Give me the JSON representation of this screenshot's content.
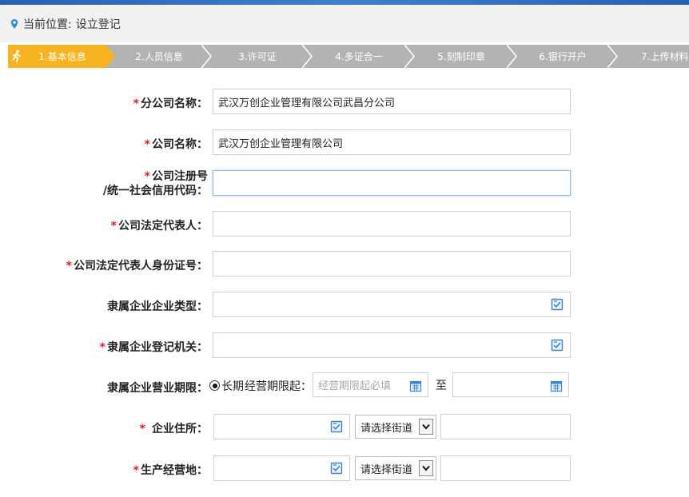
{
  "breadcrumb": {
    "prefix": "当前位置:",
    "current": "设立登记"
  },
  "steps": [
    {
      "label": "1.基本信息",
      "active": true
    },
    {
      "label": "2.人员信息",
      "active": false
    },
    {
      "label": "3.许可证",
      "active": false
    },
    {
      "label": "4.多证合一",
      "active": false
    },
    {
      "label": "5.刻制印章",
      "active": false
    },
    {
      "label": "6.银行开户",
      "active": false
    },
    {
      "label": "7.上传材料",
      "active": false
    }
  ],
  "form": {
    "branch_name": {
      "label": "分公司名称：",
      "value": "武汉万创企业管理有限公司武昌分公司",
      "required": true
    },
    "company_name": {
      "label": "公司名称：",
      "value": "武汉万创企业管理有限公司",
      "required": true
    },
    "reg_no": {
      "label_line1": "公司注册号",
      "label_line2": "/统一社会信用代码：",
      "value": "",
      "required": true
    },
    "legal_rep": {
      "label": "公司法定代表人：",
      "value": "",
      "required": true
    },
    "legal_rep_id": {
      "label": "公司法定代表人身份证号：",
      "value": "",
      "required": true
    },
    "parent_type": {
      "label": "隶属企业企业类型：",
      "value": "",
      "required": false
    },
    "parent_authority": {
      "label": "隶属企业登记机关：",
      "value": "",
      "required": true
    },
    "parent_term": {
      "label": "隶属企业营业期限：",
      "radio_label": "长期",
      "start_label": "经营期限起：",
      "start_placeholder": "经营期限起必填",
      "to_label": "至",
      "end_value": ""
    },
    "address": {
      "label": "企业住所：",
      "value": "",
      "street_select": "请选择街道",
      "detail": "",
      "required": true
    },
    "business_place": {
      "label": "生产经营地：",
      "value": "",
      "street_select": "请选择街道",
      "detail": "",
      "required": true
    }
  },
  "required_mark": "*",
  "colors": {
    "active_step": "#f7b320",
    "inactive_step": "#b3b3b3",
    "required": "#e02020",
    "top_bar": "#2a5fb0"
  }
}
